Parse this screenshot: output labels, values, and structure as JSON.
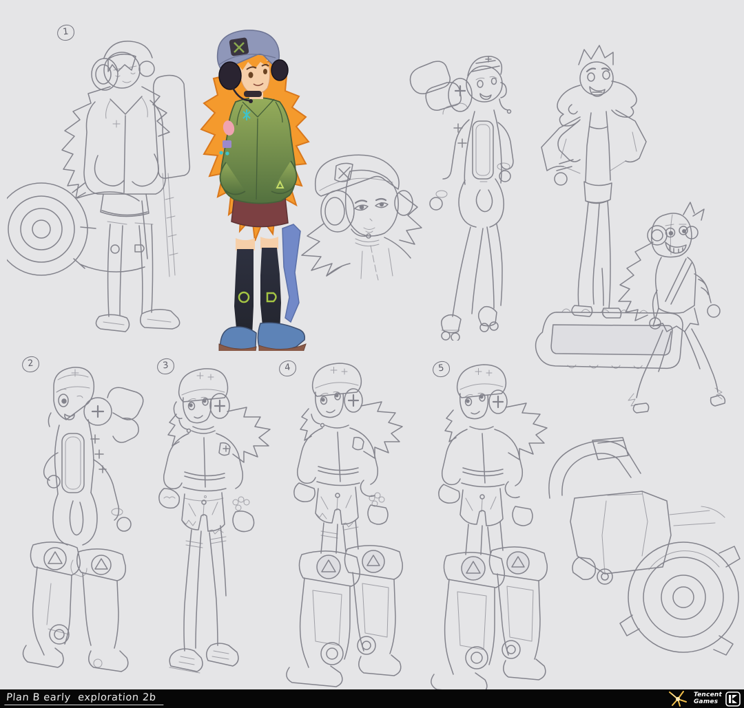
{
  "page": {
    "background_color": "#e5e5e7",
    "sketch_line_color": "#83838c",
    "bar_color": "#070707"
  },
  "caption_bar": {
    "title": "Plan B early  exploration 2b"
  },
  "branding": {
    "studio_name_line1": "Tencent",
    "studio_name_line2": "Games",
    "spark_color": "#f3c04b",
    "monogram": "K"
  },
  "annotations": [
    {
      "label": "1"
    },
    {
      "label": "2"
    },
    {
      "label": "3"
    },
    {
      "label": "4"
    },
    {
      "label": "5"
    }
  ],
  "figures": [
    {
      "id": "sketch-1",
      "name": "girl with headphones, parka and circular saw engine"
    },
    {
      "id": "colored-key",
      "name": "colored key art, orange hair, beanie, green parka"
    },
    {
      "id": "face-closeup",
      "name": "head close-up sketch"
    },
    {
      "id": "bodysuit-pose",
      "name": "slim bodysuit variant with roller skates"
    },
    {
      "id": "cape-pose",
      "name": "short-haired variant with draped jacket"
    },
    {
      "id": "gremlin-pose",
      "name": "feral variant carrying chainsaw blade"
    },
    {
      "id": "variant-2",
      "name": "bodysuit variant with mech boots, back view"
    },
    {
      "id": "variant-3",
      "name": "jacket and shorts variant with sneakers"
    },
    {
      "id": "variant-4",
      "name": "jacket variant with mechanical boots"
    },
    {
      "id": "variant-5",
      "name": "jacket variant with heavy mechanical boots"
    },
    {
      "id": "engine-study",
      "name": "saw engine study sketch"
    }
  ],
  "palette": {
    "hair": "#f49a2d",
    "hair_shadow": "#d9781d",
    "beanie": "#8f97b9",
    "beanie_patch": "#3a3440",
    "headphones": "#2a2431",
    "skin": "#f6cfa9",
    "jacket_light": "#96ad5b",
    "jacket_dark": "#53713f",
    "jacket_accent": "#3ec3cb",
    "patch_pink": "#efa3b0",
    "patch_purple": "#9c89cb",
    "shorts": "#7c4042",
    "stockings": "#23252e",
    "stocking_glyph": "#a5c544",
    "boots": "#5d83b7",
    "boot_sole": "#8a5b49",
    "ribbon": "#7289c8"
  }
}
